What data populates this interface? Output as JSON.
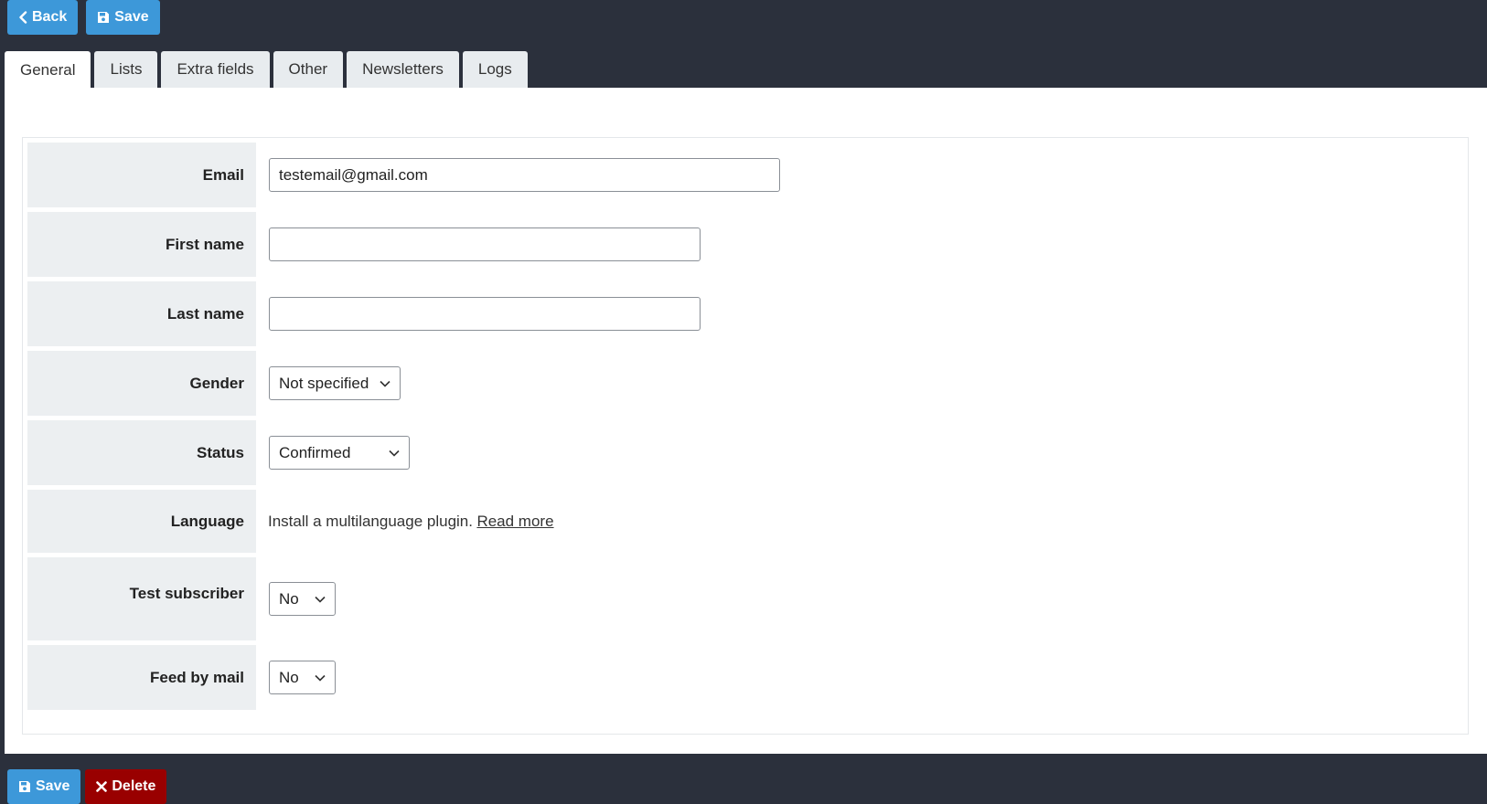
{
  "toolbar": {
    "back_label": "Back",
    "save_label": "Save"
  },
  "tabs": [
    {
      "label": "General"
    },
    {
      "label": "Lists"
    },
    {
      "label": "Extra fields"
    },
    {
      "label": "Other"
    },
    {
      "label": "Newsletters"
    },
    {
      "label": "Logs"
    }
  ],
  "form": {
    "email": {
      "label": "Email",
      "value": "testemail@gmail.com"
    },
    "first_name": {
      "label": "First name",
      "value": ""
    },
    "last_name": {
      "label": "Last name",
      "value": ""
    },
    "gender": {
      "label": "Gender",
      "selected": "Not specified"
    },
    "status": {
      "label": "Status",
      "selected": "Confirmed"
    },
    "language": {
      "label": "Language",
      "text": "Install a multilanguage plugin.",
      "link": "Read more"
    },
    "test_subscriber": {
      "label": "Test subscriber",
      "selected": "No"
    },
    "feed_by_mail": {
      "label": "Feed by mail",
      "selected": "No"
    }
  },
  "footer": {
    "save_label": "Save",
    "delete_label": "Delete"
  },
  "colors": {
    "primary": "#3d98d9",
    "danger": "#990000",
    "background": "#2b303c",
    "label_bg": "#eceff1"
  },
  "icons": {
    "back": "chevron-left-icon",
    "save": "floppy-disk-icon",
    "delete": "x-icon",
    "select": "chevron-down-icon"
  }
}
